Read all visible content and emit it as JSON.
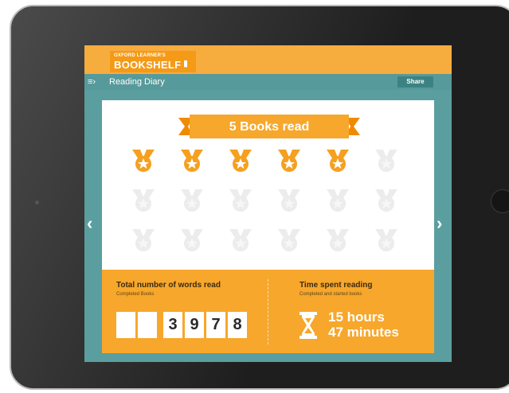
{
  "logo": {
    "line1": "OXFORD LEARNER'S",
    "line2": "BOOKSHELF"
  },
  "nav": {
    "title": "Reading Diary",
    "share_label": "Share"
  },
  "banner": {
    "label": "5 Books read"
  },
  "medals": {
    "earned": 5,
    "total": 18,
    "per_row": 6
  },
  "stats": {
    "words_title": "Total number of words read",
    "words_sub": "Completed Books",
    "digits": [
      "",
      "",
      "3",
      "9",
      "7",
      "8"
    ],
    "time_title": "Time spent reading",
    "time_sub": "Completed and started books",
    "time_hours": "15 hours",
    "time_minutes": "47 minutes"
  },
  "colors": {
    "accent": "#f7ac3e",
    "medal_earned": "#f5a01f",
    "medal_locked": "#ececec",
    "teal": "#5b9ea0"
  },
  "icons": [
    "menu-icon",
    "bookshelf-icon",
    "ribbon-icon",
    "medal-icon",
    "hourglass-icon",
    "chevron-left-icon",
    "chevron-right-icon"
  ]
}
